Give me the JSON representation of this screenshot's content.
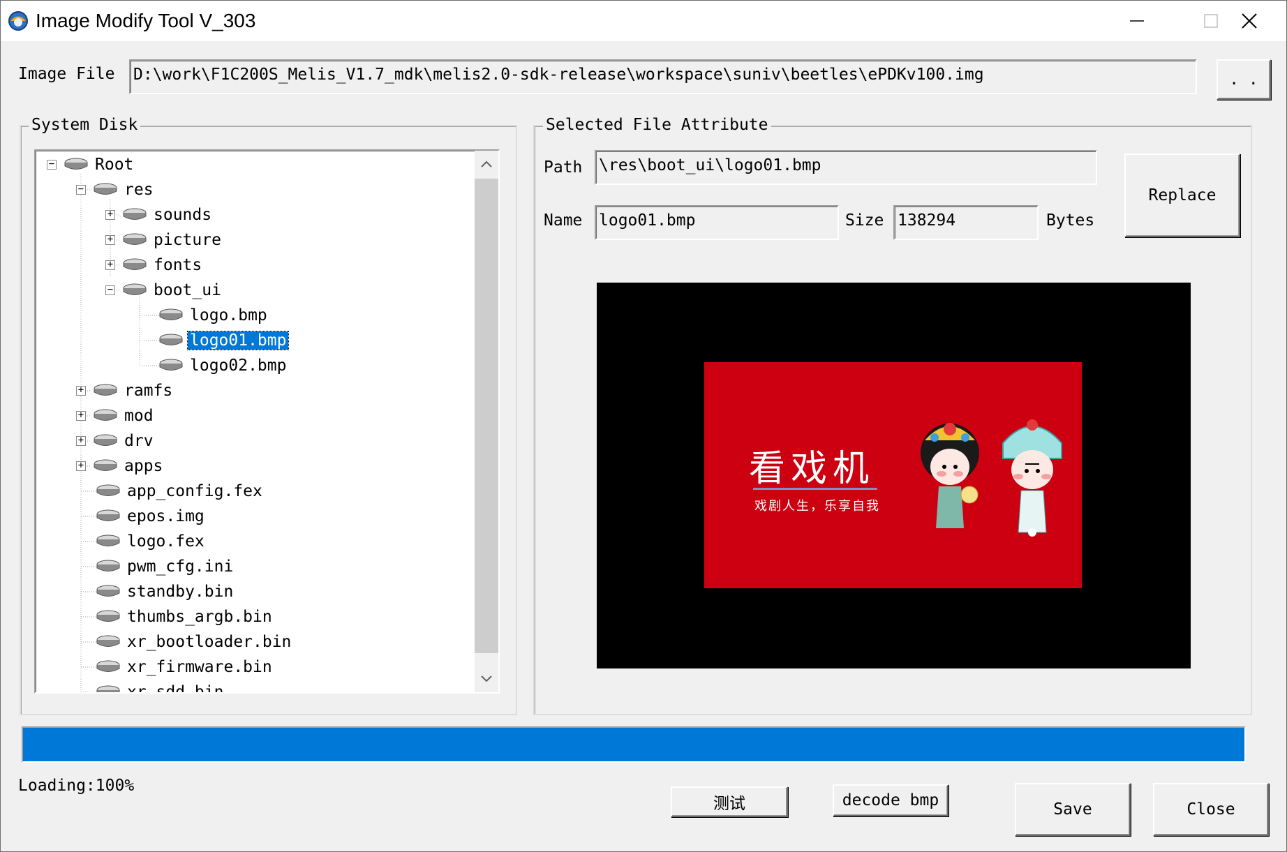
{
  "window": {
    "title": "Image Modify Tool V_303"
  },
  "image_file": {
    "label": "Image File",
    "value": "D:\\work\\F1C200S_Melis_V1.7_mdk\\melis2.0-sdk-release\\workspace\\suniv\\beetles\\ePDKv100.img",
    "browse_label": ". ."
  },
  "system_disk": {
    "label": "System Disk",
    "items": [
      {
        "label": "Root"
      },
      {
        "label": "res"
      },
      {
        "label": "sounds"
      },
      {
        "label": "picture"
      },
      {
        "label": "fonts"
      },
      {
        "label": "boot_ui"
      },
      {
        "label": "logo.bmp"
      },
      {
        "label": "logo01.bmp"
      },
      {
        "label": "logo02.bmp"
      },
      {
        "label": "ramfs"
      },
      {
        "label": "mod"
      },
      {
        "label": "drv"
      },
      {
        "label": "apps"
      },
      {
        "label": "app_config.fex"
      },
      {
        "label": "epos.img"
      },
      {
        "label": "logo.fex"
      },
      {
        "label": "pwm_cfg.ini"
      },
      {
        "label": "standby.bin"
      },
      {
        "label": "thumbs_argb.bin"
      },
      {
        "label": "xr_bootloader.bin"
      },
      {
        "label": "xr_firmware.bin"
      },
      {
        "label": "xr_sdd.bin"
      }
    ]
  },
  "attributes": {
    "label": "Selected File Attribute",
    "path_label": "Path",
    "path_value": "\\res\\boot_ui\\logo01.bmp",
    "name_label": "Name",
    "name_value": "logo01.bmp",
    "size_label": "Size",
    "size_value": "138294",
    "bytes_label": "Bytes",
    "replace_label": "Replace"
  },
  "preview": {
    "logo_title": "看戏机",
    "logo_subtitle": "戏剧人生，乐享自我",
    "card_color": "#cc0010"
  },
  "status": {
    "loading_text": "Loading:100%",
    "progress": 1.0,
    "progress_color": "#0078d7"
  },
  "buttons": {
    "test_label": "测试",
    "decode_label": "decode bmp",
    "save_label": "Save",
    "close_label": "Close"
  }
}
